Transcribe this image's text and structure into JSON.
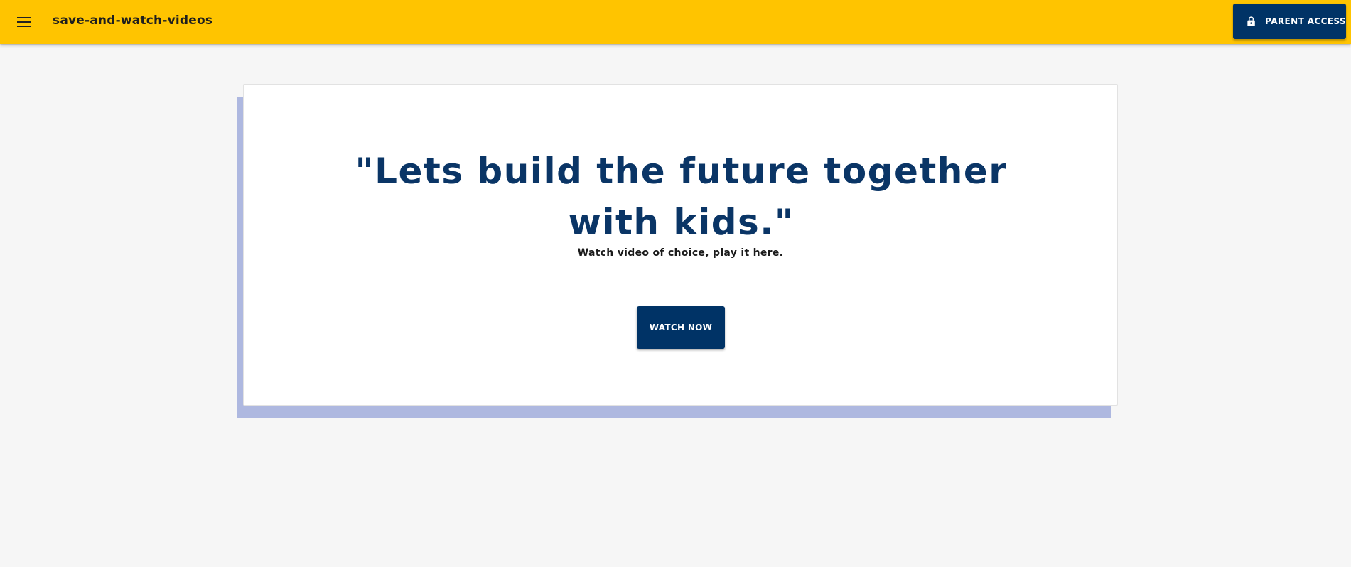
{
  "header": {
    "menu_icon": "menu-icon",
    "app_title": "save-and-watch-videos",
    "parent_access": {
      "label": "PARENT ACCESS",
      "icon": "lock-icon"
    },
    "accent_color": "#ffc400"
  },
  "hero": {
    "heading": "\"Lets build the future together with kids.\"",
    "subtitle": "Watch video of choice, play it here.",
    "cta_label": "WATCH NOW"
  },
  "colors": {
    "primary": "#003366",
    "heading": "#0a3566",
    "card_shadow": "#aeb8e0",
    "background": "#f6f6f6"
  }
}
